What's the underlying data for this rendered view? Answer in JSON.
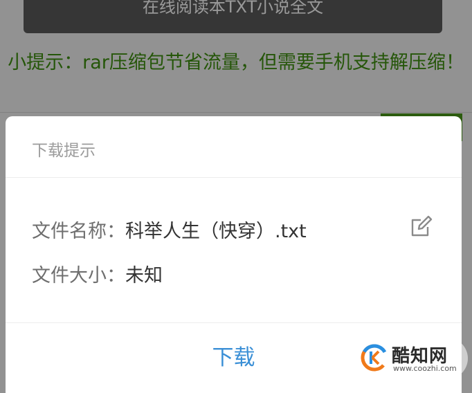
{
  "background": {
    "read_button_label": "在线阅读本TXT小说全文",
    "tip_text": "小提示：rar压缩包节省流量，但需要手机支持解压缩！"
  },
  "dialog": {
    "title": "下载提示",
    "file_name_label": "文件名称：",
    "file_name_value": "科举人生（快穿）.txt",
    "file_size_label": "文件大小：",
    "file_size_value": "未知",
    "download_label": "下载",
    "edit_icon": "edit-icon"
  },
  "watermark": {
    "brand": "酷知网",
    "url": "www.coozhi.com"
  },
  "colors": {
    "tip_green": "#3f8f10",
    "download_blue": "#3a8fd6",
    "logo_orange": "#f07a1a",
    "logo_blue": "#2a8fe0"
  }
}
